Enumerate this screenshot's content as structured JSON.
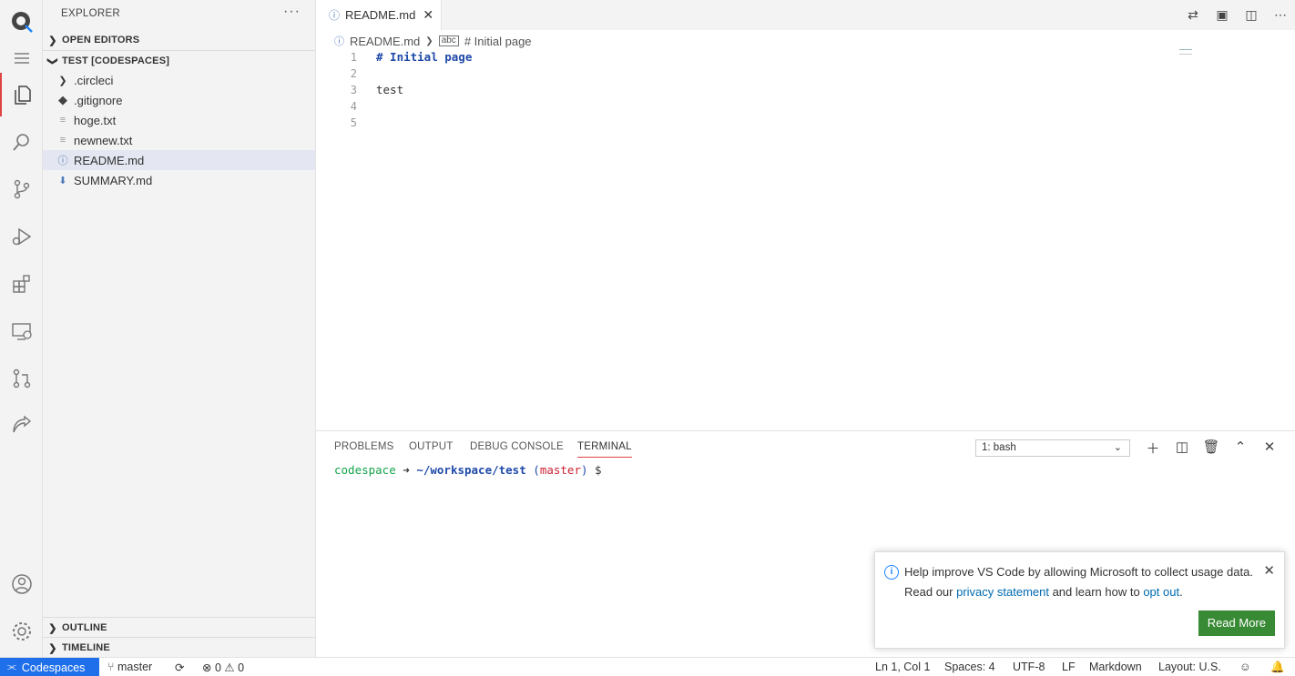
{
  "activity_bar": {
    "items": [
      "github-logo-icon",
      "hamburger-menu-icon",
      "files-icon",
      "search-icon",
      "source-control-icon",
      "run-debug-icon",
      "extensions-icon",
      "remote-explorer-icon",
      "pull-requests-icon",
      "live-share-icon",
      "account-icon",
      "settings-gear-icon"
    ]
  },
  "sidebar": {
    "title": "EXPLORER",
    "more": "···",
    "open_editors": "OPEN EDITORS",
    "workspace": "TEST [CODESPACES]",
    "files": [
      {
        "name": ".circleci",
        "icon": "chevron-right-icon"
      },
      {
        "name": ".gitignore",
        "icon": "git-icon"
      },
      {
        "name": "hoge.txt",
        "icon": "text-file-icon"
      },
      {
        "name": "newnew.txt",
        "icon": "text-file-icon"
      },
      {
        "name": "README.md",
        "icon": "info-icon"
      },
      {
        "name": "SUMMARY.md",
        "icon": "markdown-down-icon"
      }
    ],
    "outline": "OUTLINE",
    "timeline": "TIMELINE"
  },
  "editor": {
    "tab_label": "README.md",
    "breadcrumb_file": "README.md",
    "breadcrumb_symbol": "# Initial page",
    "line_numbers": [
      "1",
      "2",
      "3",
      "4",
      "5"
    ],
    "lines": [
      "# Initial page",
      "",
      "test",
      "",
      ""
    ]
  },
  "panel": {
    "tabs": [
      "PROBLEMS",
      "OUTPUT",
      "DEBUG CONSOLE",
      "TERMINAL"
    ],
    "terminal_select": "1: bash",
    "prompt_user": "codespace",
    "prompt_arrow": "➜",
    "prompt_path": "~/workspace/test",
    "prompt_branch_open": "(",
    "prompt_branch": "master",
    "prompt_branch_close": ")",
    "prompt_symbol": "$"
  },
  "notification": {
    "text_before": "Help improve VS Code by allowing Microsoft to collect usage data. Read our ",
    "link1": "privacy statement",
    "text_mid": " and learn how to ",
    "link2": "opt out",
    "text_after": ".",
    "button": "Read More"
  },
  "status_bar": {
    "remote": "Codespaces",
    "branch": "master",
    "errors": "0",
    "warnings": "0",
    "position": "Ln 1, Col 1",
    "spaces": "Spaces: 4",
    "encoding": "UTF-8",
    "eol": "LF",
    "language": "Markdown",
    "layout": "Layout: U.S."
  },
  "colors": {
    "accent_red": "#dd4444",
    "link_blue": "#006ab1",
    "button_green": "#388a34",
    "remote_blue": "#1f6feb"
  }
}
